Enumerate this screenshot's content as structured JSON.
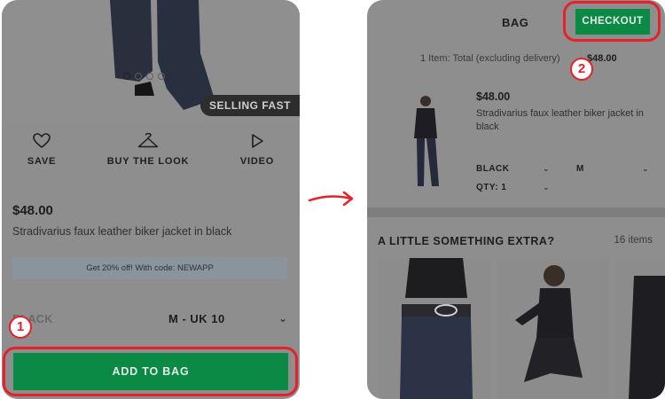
{
  "left_screen": {
    "badge": "SELLING FAST",
    "actions": [
      {
        "label": "SAVE",
        "icon": "heart-icon"
      },
      {
        "label": "BUY THE LOOK",
        "icon": "hanger-icon"
      },
      {
        "label": "VIDEO",
        "icon": "play-icon"
      }
    ],
    "price": "$48.00",
    "product_name": "Stradivarius faux leather biker jacket in black",
    "promo": "Get 20% off! With code: NEWAPP",
    "color_value": "BLACK",
    "size_value": "M - UK 10",
    "add_to_bag": "ADD TO BAG",
    "carousel_dots": 4,
    "carousel_active_index": 0
  },
  "markers": {
    "one": "1",
    "two": "2"
  },
  "right_screen": {
    "title": "BAG",
    "checkout": "CHECKOUT",
    "items_total": "1 Item: Total (excluding delivery)",
    "total_amount": "$48.00",
    "item": {
      "price": "$48.00",
      "name": "Stradivarius faux leather biker jacket in black",
      "color": "BLACK",
      "size": "M",
      "qty": "QTY: 1"
    },
    "extra_title": "A LITTLE SOMETHING EXTRA?",
    "extra_count": "16 items"
  },
  "colors": {
    "overlay_gray": "#8e8e8e",
    "green_button": "#0a8a45",
    "highlight_red": "#e8202a"
  }
}
